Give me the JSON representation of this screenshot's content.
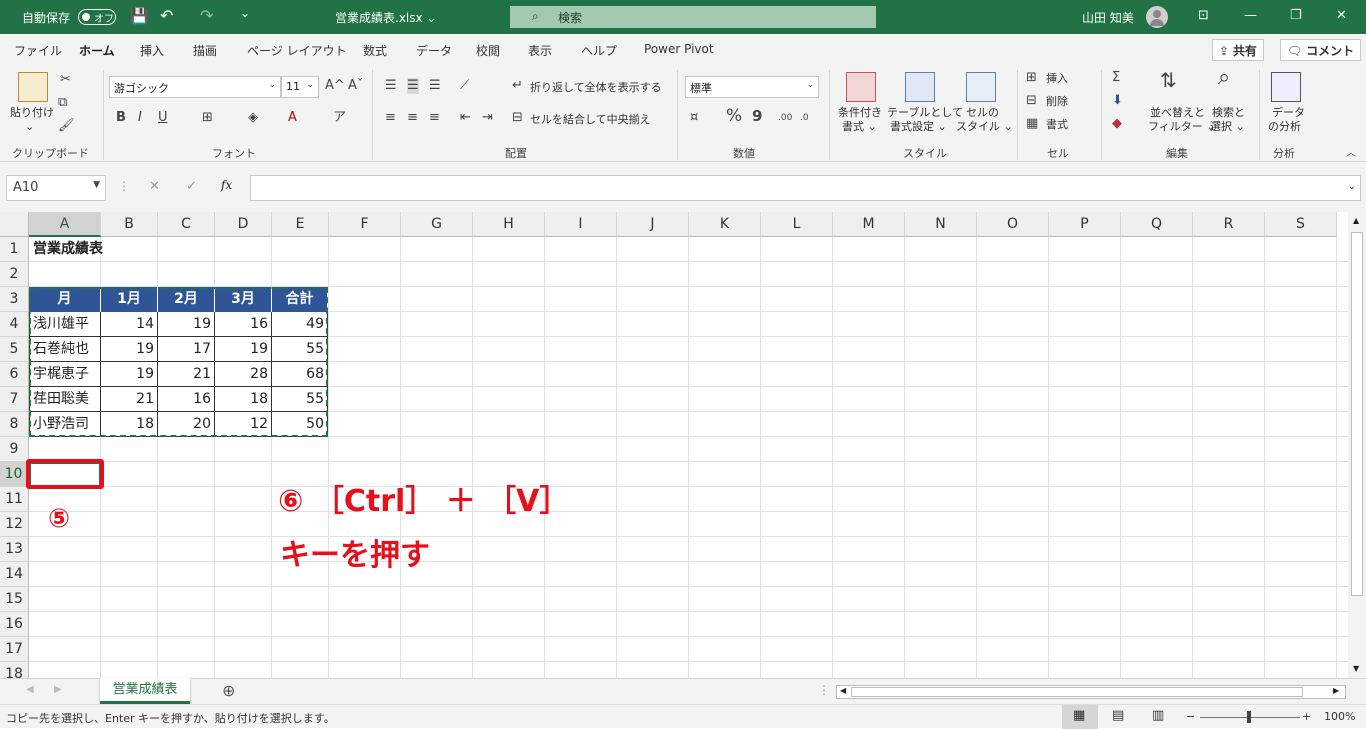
{
  "titlebar": {
    "autosave": "自動保存",
    "toggle": "オフ",
    "filename": "営業成績表.xlsx ⌄",
    "search": "検索",
    "user": "山田 知美",
    "minimize": "—",
    "restore": "❐",
    "close": "✕",
    "ribbon_display": "⊡",
    "save_icon": "💾",
    "undo": "↶",
    "redo": "↷"
  },
  "tabs": [
    "ファイル",
    "ホーム",
    "挿入",
    "描画",
    "ページ レイアウト",
    "数式",
    "データ",
    "校閲",
    "表示",
    "ヘルプ",
    "Power Pivot"
  ],
  "share": "共有",
  "comment": "コメント",
  "ribbon": {
    "clipboard": {
      "paste": "貼り付け",
      "label": "クリップボード"
    },
    "font": {
      "name": "游ゴシック",
      "size": "11",
      "grow": "A^",
      "shrink": "Aˇ",
      "bold": "B",
      "italic": "I",
      "underline": "U",
      "label": "フォント"
    },
    "alignment": {
      "wrap": "折り返して全体を表示する",
      "merge": "セルを結合して中央揃え",
      "label": "配置"
    },
    "number": {
      "format": "標準",
      "percent": "%",
      "comma": "9",
      "label": "数値"
    },
    "styles": {
      "conditional1": "条件付き",
      "conditional2": "書式 ⌄",
      "table1": "テーブルとして",
      "table2": "書式設定 ⌄",
      "cell1": "セルの",
      "cell2": "スタイル ⌄",
      "label": "スタイル"
    },
    "cells": {
      "insert": "挿入",
      "delete": "削除",
      "format": "書式",
      "label": "セル"
    },
    "editing": {
      "sort1": "並べ替えと",
      "sort2": "フィルター ⌄",
      "find1": "検索と",
      "find2": "選択 ⌄",
      "label": "編集"
    },
    "analysis": {
      "data1": "データ",
      "data2": "の分析",
      "label": "分析"
    }
  },
  "formula": {
    "namebox": "A10",
    "cancel": "✕",
    "enter": "✓",
    "fx": "fx",
    "value": ""
  },
  "grid": {
    "columns": [
      "A",
      "B",
      "C",
      "D",
      "E",
      "F",
      "G",
      "H",
      "I",
      "J",
      "K",
      "L",
      "M",
      "N",
      "O",
      "P",
      "Q",
      "R",
      "S"
    ],
    "rows": [
      "1",
      "2",
      "3",
      "4",
      "5",
      "6",
      "7",
      "8",
      "9",
      "10",
      "11",
      "12",
      "13",
      "14",
      "15",
      "16",
      "17",
      "18"
    ],
    "title": "営業成績表",
    "table_header": [
      "月",
      "1月",
      "2月",
      "3月",
      "合計"
    ],
    "table_rows": [
      [
        "浅川雄平",
        "14",
        "19",
        "16",
        "49"
      ],
      [
        "石巻純也",
        "19",
        "17",
        "19",
        "55"
      ],
      [
        "宇梶恵子",
        "19",
        "21",
        "28",
        "68"
      ],
      [
        "荏田聡美",
        "21",
        "16",
        "18",
        "55"
      ],
      [
        "小野浩司",
        "18",
        "20",
        "12",
        "50"
      ]
    ]
  },
  "annotations": {
    "step5": "⑤",
    "step6_line1": "⑥ ［Ctrl］ ＋ ［V］",
    "step6_line2": "キーを押す"
  },
  "sheet": {
    "name": "営業成績表",
    "add": "⊕"
  },
  "status": {
    "message": "コピー先を選択し、Enter キーを押すか、貼り付けを選択します。",
    "zoom": "100%"
  },
  "colors": {
    "accent": "#217346",
    "header": "#2f5597",
    "annotation": "#e5101b"
  }
}
